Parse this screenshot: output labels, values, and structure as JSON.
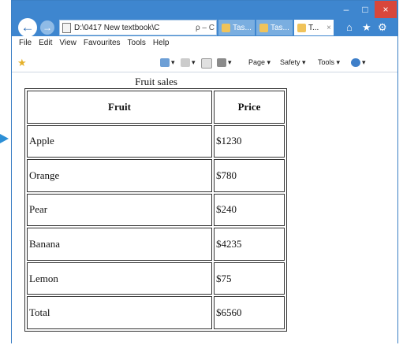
{
  "browser": {
    "address": "D:\\0417 New textbook\\C",
    "address_controls": "ρ – C",
    "tabs": [
      {
        "label": "Tas..."
      },
      {
        "label": "Tas..."
      },
      {
        "label": "T...",
        "close": "×"
      }
    ],
    "window_controls": {
      "minimize": "–",
      "maximize": "□",
      "close": "×"
    },
    "menu": [
      "File",
      "Edit",
      "View",
      "Favourites",
      "Tools",
      "Help"
    ],
    "command_bar": {
      "page": "Page ▾",
      "safety": "Safety ▾",
      "tools": "Tools ▾",
      "help": "▾"
    },
    "accent_color": "#3e86cf"
  },
  "table": {
    "caption": "Fruit sales",
    "headers": [
      "Fruit",
      "Price"
    ],
    "rows": [
      [
        "Apple",
        "$1230"
      ],
      [
        "Orange",
        "$780"
      ],
      [
        "Pear",
        "$240"
      ],
      [
        "Banana",
        "$4235"
      ],
      [
        "Lemon",
        "$75"
      ],
      [
        "Total",
        "$6560"
      ]
    ]
  }
}
